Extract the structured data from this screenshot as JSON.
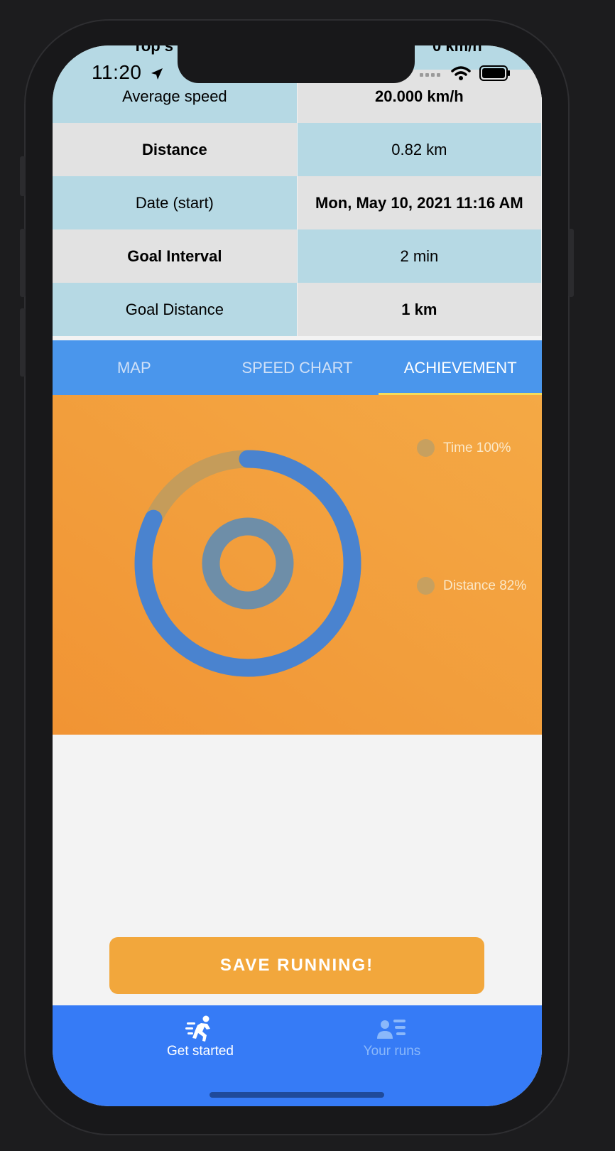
{
  "status": {
    "time": "11:20"
  },
  "stats": {
    "peek_left": "Top s",
    "peek_right": "0 km/h",
    "rows": [
      {
        "label": "Average speed",
        "value": "20.000 km/h"
      },
      {
        "label": "Distance",
        "value": "0.82 km"
      },
      {
        "label": "Date (start)",
        "value": "Mon, May 10, 2021 11:16 AM"
      },
      {
        "label": "Goal Interval",
        "value": "2 min"
      },
      {
        "label": "Goal Distance",
        "value": "1 km"
      }
    ]
  },
  "tabs": [
    {
      "label": "MAP",
      "active": false
    },
    {
      "label": "SPEED CHART",
      "active": false
    },
    {
      "label": "ACHIEVEMENT",
      "active": true
    }
  ],
  "achievement": {
    "legend": [
      {
        "label": "Time 100%",
        "value": 1.0
      },
      {
        "label": "Distance 82%",
        "value": 0.82
      }
    ],
    "colors": {
      "progress": "#4a83cf",
      "track": "#c59c5a",
      "inner": "#6e8ea8",
      "background": "#f2a03c"
    }
  },
  "save_button": {
    "label": "SAVE RUNNING!"
  },
  "nav": {
    "items": [
      {
        "label": "Get started",
        "icon": "runner-icon",
        "active": true
      },
      {
        "label": "Your runs",
        "icon": "person-list-icon",
        "active": false
      }
    ]
  },
  "colors": {
    "accent": "#367bf6",
    "tab_bar": "#4a96ec",
    "button": "#f2a73c",
    "table_blue": "#b6d9e4",
    "table_gray": "#e2e2e2"
  }
}
